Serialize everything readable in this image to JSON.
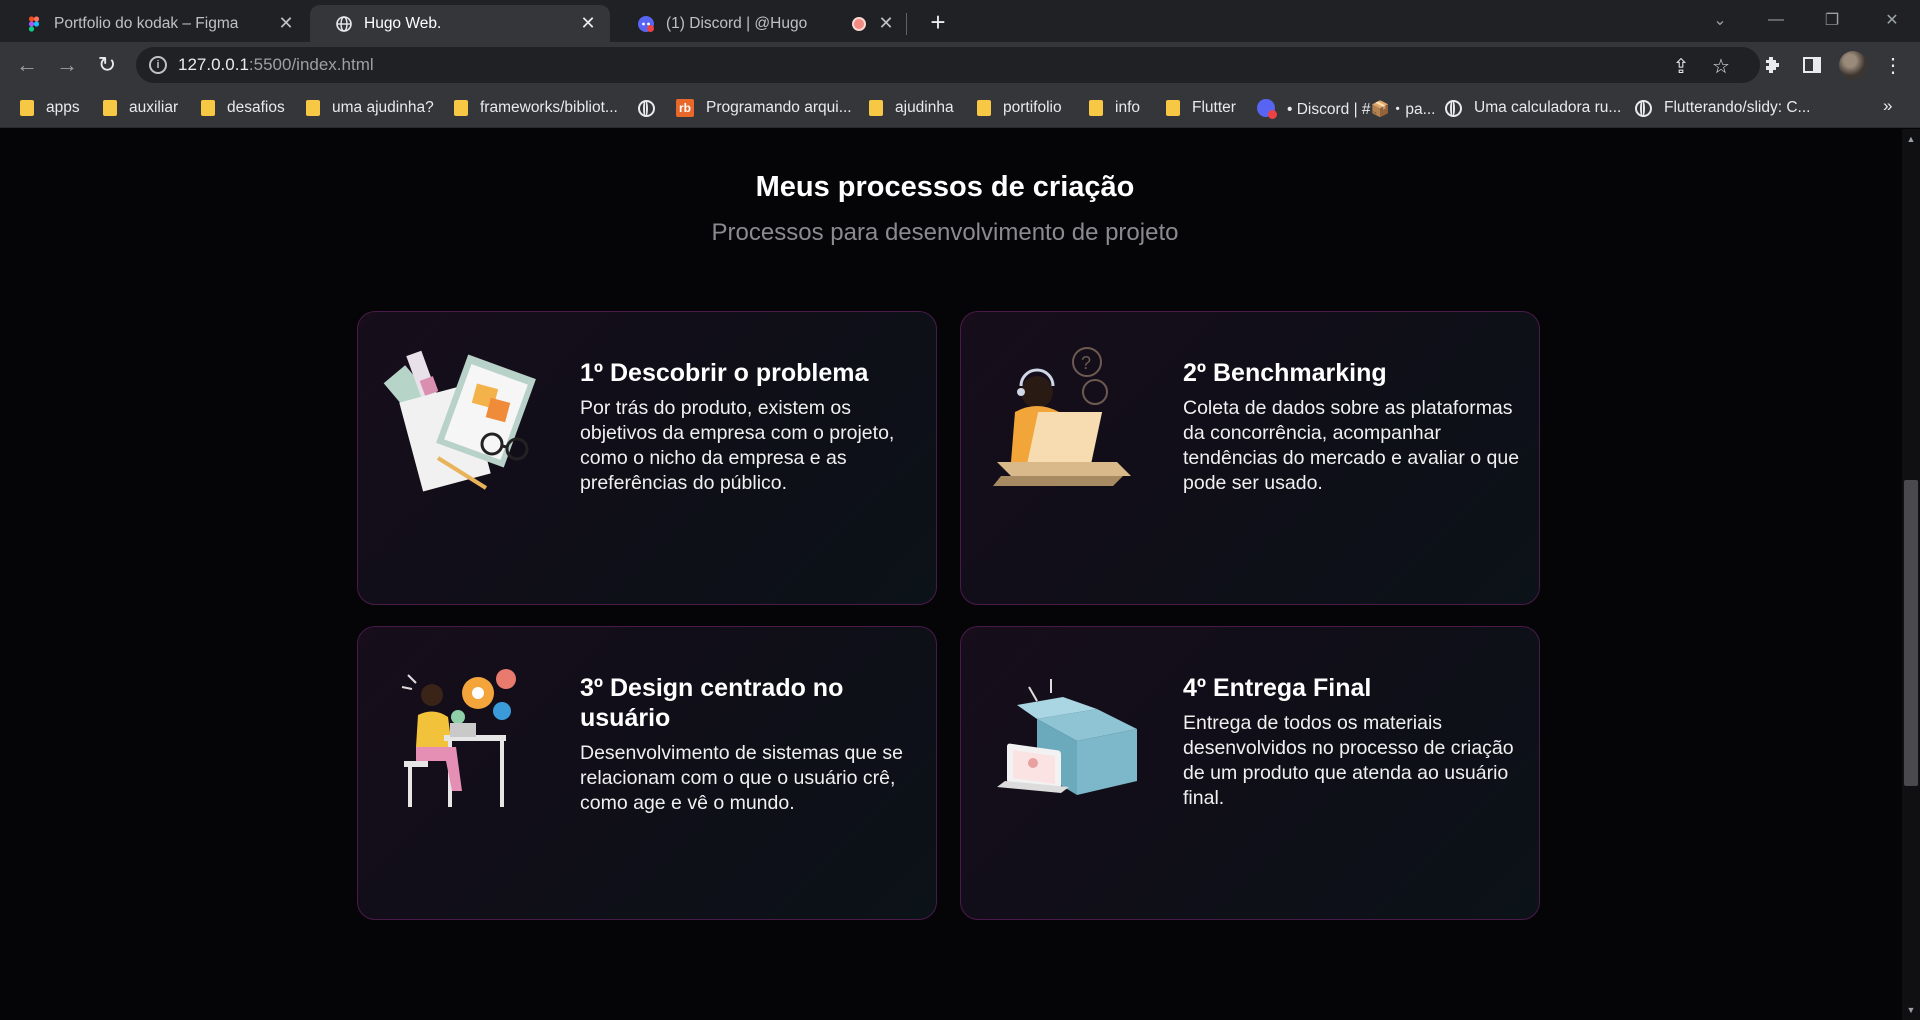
{
  "browser": {
    "tabs": [
      {
        "title": "Portfolio do kodak – Figma",
        "icon": "figma-icon"
      },
      {
        "title": "Hugo Web.",
        "icon": "globe-icon",
        "active": true
      },
      {
        "title": "(1) Discord | @Hugo",
        "icon": "discord-icon",
        "recording": true
      }
    ],
    "url_host": "127.0.0.1",
    "url_path": ":5500/index.html",
    "bookmarks": [
      {
        "label": "apps",
        "icon": "folder-icon"
      },
      {
        "label": "auxiliar",
        "icon": "folder-icon"
      },
      {
        "label": "desafios",
        "icon": "folder-icon"
      },
      {
        "label": "uma ajudinha?",
        "icon": "folder-icon"
      },
      {
        "label": "frameworks/bibliot...",
        "icon": "folder-icon"
      },
      {
        "label": "",
        "icon": "globe-icon"
      },
      {
        "label": "Programando arqui...",
        "icon": "rb-icon"
      },
      {
        "label": "ajudinha",
        "icon": "folder-icon"
      },
      {
        "label": "portifolio",
        "icon": "folder-icon"
      },
      {
        "label": "info",
        "icon": "folder-icon"
      },
      {
        "label": "Flutter",
        "icon": "folder-icon"
      },
      {
        "label": "• Discord | #📦・pa...",
        "icon": "discord-icon"
      },
      {
        "label": "Uma calculadora ru...",
        "icon": "globe-icon"
      },
      {
        "label": "Flutterando/slidy: C...",
        "icon": "globe-icon"
      }
    ],
    "bookmarks_more": "»"
  },
  "section": {
    "title": "Meus processos de criação",
    "subtitle": "Processos para desenvolvimento de projeto"
  },
  "cards": [
    {
      "title": "1º Descobrir o problema",
      "description": "Por trás do produto, existem os objetivos da empresa com o projeto, como o nicho da empresa e as preferências do público.",
      "illustration": "desk-papers-illustration"
    },
    {
      "title": "2º Benchmarking",
      "description": "Coleta de dados sobre as plataformas da concorrência, acompanhar tendências do mercado e avaliar o que pode ser usado.",
      "illustration": "support-laptop-illustration"
    },
    {
      "title": "3º Design centrado no usuário",
      "description": "Desenvolvimento de sistemas que se relacionam com o que o usuário crê, como age e vê o mundo.",
      "illustration": "woman-desk-illustration"
    },
    {
      "title": "4º Entrega Final",
      "description": "Entrega de todos os materiais desenvolvidos no processo de criação de um produto que atenda ao usuário final.",
      "illustration": "delivery-box-illustration"
    }
  ]
}
